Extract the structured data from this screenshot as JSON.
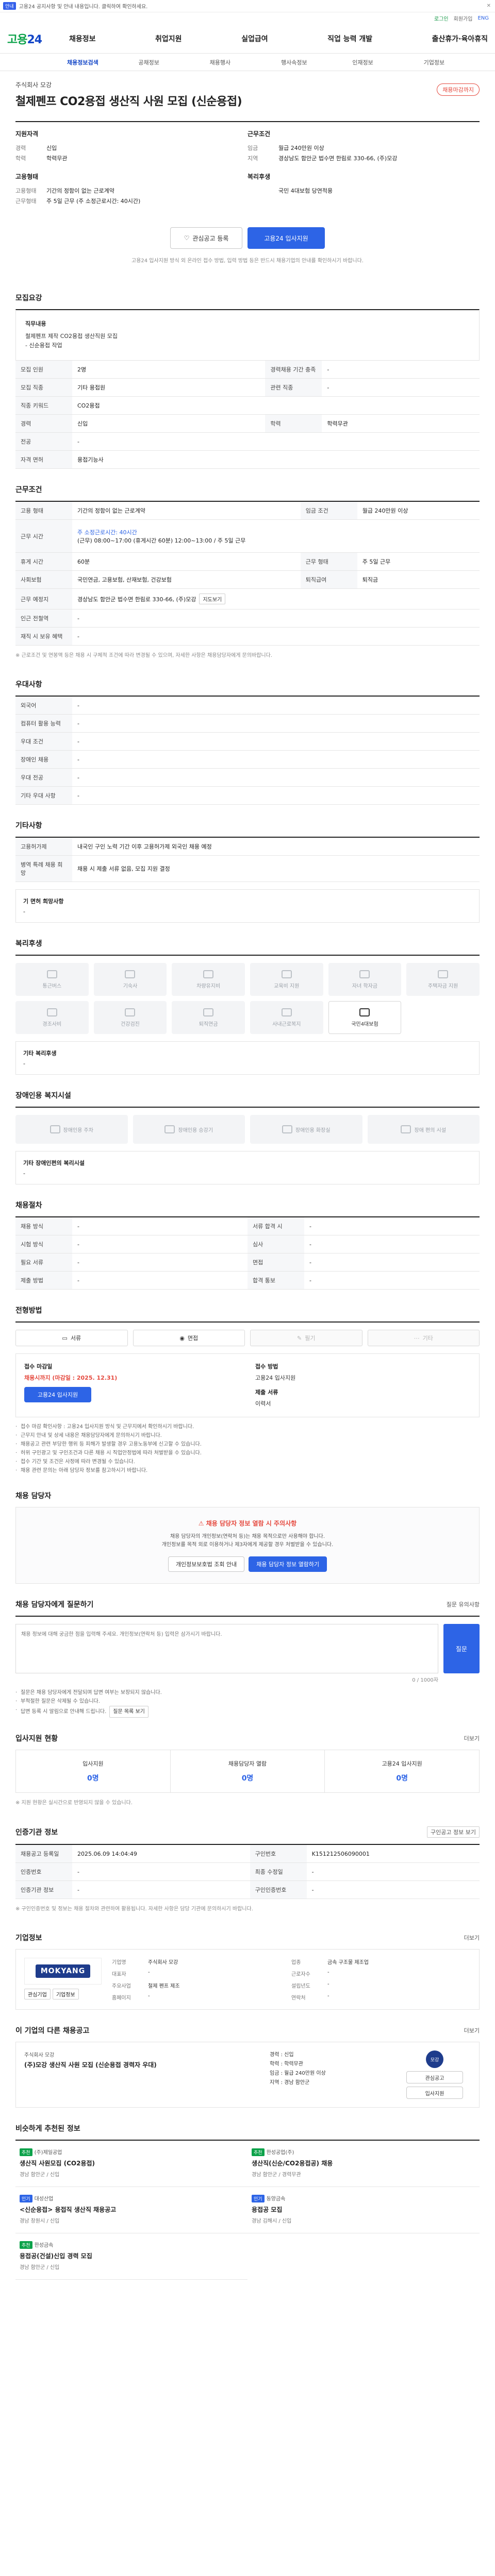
{
  "notice": {
    "tag": "안내",
    "text": "고용24 공지사항 및 안내 내용입니다. 클릭하여 확인하세요.",
    "close": "✕"
  },
  "util": {
    "items": [
      "로그인",
      "회원가입",
      "ENG"
    ]
  },
  "gnb": {
    "logo_main": "고용",
    "logo_num": "24",
    "menu": [
      "채용정보",
      "취업지원",
      "실업급여",
      "직업 능력 개발",
      "출산휴가·육아휴직"
    ]
  },
  "subnav": {
    "items": [
      "채용정보검색",
      "공채정보",
      "채용행사",
      "행사속정보",
      "인재정보",
      "기업정보"
    ]
  },
  "header": {
    "company": "주식회사 모강",
    "title": "철제펜프 CO2용접 생산직 사원 모집 (신순용접)",
    "dday": "채용마감까지",
    "left_title": "지원자격",
    "left": [
      {
        "k": "경력",
        "v": "신입"
      },
      {
        "k": "학력",
        "v": "학력무관"
      }
    ],
    "left_title2": "고용형태",
    "left2": [
      {
        "k": "고용형태",
        "v": "기간의 정함이 없는 근로계약"
      },
      {
        "k": "근무형태",
        "v": "주 5일 근무 (주 소정근로시간: 40시간)"
      }
    ],
    "right_title": "근무조건",
    "right": [
      {
        "k": "임금",
        "v": "월급 240만원 이상"
      },
      {
        "k": "지역",
        "v": "경상남도 함안군 법수면 한림로 330-66, (주)모강"
      }
    ],
    "right_title2": "복리후생",
    "right2": [
      {
        "k": "",
        "v": "국민 4대보험 당연적용"
      }
    ]
  },
  "actions": {
    "save": "관심공고 등록",
    "apply": "고용24 입사지원"
  },
  "action_note": "고용24 입사지원 방식 외 온라인 접수 방법, 입력 방법 등은 반드시 채용기업의 안내를 확인하시기 바랍니다.",
  "job_desc": {
    "title": "모집요강",
    "label": "직무내용",
    "lines": [
      "철제펜프 제작 CO2용접 생산직원 모집",
      "- 신순용접 작업"
    ]
  },
  "recruit_table": {
    "rows": [
      [
        {
          "k": "모집 인원",
          "v": "2명"
        },
        {
          "k": "경력채용 기간 충족",
          "v": "-"
        }
      ],
      [
        {
          "k": "모집 직종",
          "v": "기타 용접원"
        },
        {
          "k": "관련 직종",
          "v": "-"
        }
      ],
      [
        {
          "k": "직종 키워드",
          "v": "CO2용접"
        },
        {
          "k": "",
          "v": ""
        }
      ],
      [
        {
          "k": "경력",
          "v": "신입"
        },
        {
          "k": "학력",
          "v": "학력무관"
        }
      ],
      [
        {
          "k": "전공",
          "v": "-"
        },
        {
          "k": "",
          "v": ""
        }
      ],
      [
        {
          "k": "자격 면허",
          "v": "용접기능사"
        },
        {
          "k": "",
          "v": ""
        }
      ]
    ]
  },
  "work_cond": {
    "title": "근무조건",
    "rows": [
      [
        {
          "k": "고용 형태",
          "v": "기간의 정함이 없는 근로계약"
        },
        {
          "k": "임금 조건",
          "v": "월급 240만원 이상"
        }
      ],
      [
        {
          "k": "",
          "v": "주 소정근로시간: 40시간"
        },
        {
          "k": "",
          "v": ""
        }
      ],
      [
        {
          "k": "근무 시간",
          "v": "(근무) 08:00~17:00 (휴게시간 60분) 12:00~13:00 / 주 5일 근무"
        },
        {
          "k": "",
          "v": ""
        }
      ],
      [
        {
          "k": "휴게 시간",
          "v": "60분"
        },
        {
          "k": "근무 형태",
          "v": "주 5일 근무"
        }
      ],
      [
        {
          "k": "사회보험",
          "v": "국민연금, 고용보험, 산재보험, 건강보험"
        },
        {
          "k": "퇴직급여",
          "v": "퇴직금"
        }
      ],
      [
        {
          "k": "근무 예정지",
          "v": "경상남도 함안군 법수면 한림로 330-66, (주)모강"
        },
        {
          "k": "",
          "v": ""
        }
      ],
      [
        {
          "k": "인근 전철역",
          "v": "-"
        },
        {
          "k": "",
          "v": ""
        }
      ],
      [
        {
          "k": "재직 시 보유 혜택",
          "v": "-"
        },
        {
          "k": "",
          "v": ""
        }
      ]
    ],
    "map_btn": "지도보기",
    "hint": "※ 근로조건 및 연봉액 등은 채용 시 구체적 조건에 따라 변경될 수 있으며, 자세한 사항은 채용담당자에게 문의바랍니다."
  },
  "pref": {
    "title": "우대사항",
    "rows": [
      {
        "k": "외국어",
        "v": "-"
      },
      {
        "k": "컴퓨터 활용 능력",
        "v": "-"
      },
      {
        "k": "우대 조건",
        "v": "-"
      },
      {
        "k": "장애인 채용",
        "v": "-"
      },
      {
        "k": "우대 전공",
        "v": "-"
      },
      {
        "k": "기타 우대 사항",
        "v": "-"
      }
    ]
  },
  "other": {
    "title": "기타사항",
    "rows": [
      {
        "k": "고용허가제",
        "v": "내국인 구인 노력 기간 이후 고용허가제 외국인 채용 예정"
      },
      {
        "k": "병역 특례 채용 희망",
        "v": "채용 시 제출 서류 없음, 모집 지원 결정"
      }
    ],
    "extra_label": "기 면허 희망사항",
    "extra_val": "-"
  },
  "welfare": {
    "title": "복리후생",
    "items": [
      {
        "label": "통근버스",
        "on": false
      },
      {
        "label": "기숙사",
        "on": false
      },
      {
        "label": "차량유지비",
        "on": false
      },
      {
        "label": "교육비 지원",
        "on": false
      },
      {
        "label": "자녀 학자금",
        "on": false
      },
      {
        "label": "주택자금 지원",
        "on": false
      },
      {
        "label": "경조사비",
        "on": false
      },
      {
        "label": "건강검진",
        "on": false
      },
      {
        "label": "퇴직연금",
        "on": false
      },
      {
        "label": "사내근로복지",
        "on": false
      },
      {
        "label": "국민4대보험",
        "on": true
      }
    ],
    "desc_label": "기타 복리후생",
    "desc_val": "-"
  },
  "disabled": {
    "title": "장애인용 복지시설",
    "items": [
      "장애인용 주차",
      "장애인용 승강기",
      "장애인용 화장실",
      "장애 편의 시설"
    ],
    "desc_label": "기타 장애인편의 복리시설",
    "desc_val": "-"
  },
  "process": {
    "title": "채용절차",
    "rows": [
      {
        "k": "채용 방식",
        "v": "-"
      },
      {
        "k": "시험 방식",
        "v": "-"
      },
      {
        "k": "필요 서류",
        "v": "-"
      },
      {
        "k": "제출 방법",
        "v": "-"
      }
    ],
    "right": [
      {
        "k": "서류 합격 시",
        "v": "-"
      },
      {
        "k": "심사",
        "v": "-"
      },
      {
        "k": "면접",
        "v": "-"
      },
      {
        "k": "합격 통보",
        "v": "-"
      }
    ]
  },
  "apply_method": {
    "title": "전형방법",
    "methods": [
      {
        "label": "서류",
        "off": false
      },
      {
        "label": "면접",
        "off": false
      },
      {
        "label": "필기",
        "off": true
      },
      {
        "label": "기타",
        "off": true
      }
    ],
    "deadline_label": "접수 마감일",
    "deadline_val": "채용시까지 (마감일 : 2025. 12.31)",
    "method_label": "접수 방법",
    "method_val": "고용24 입사지원",
    "method_label2": "제출 서류",
    "method_val2": "이력서",
    "btn": "고용24 입사지원",
    "bullets": [
      "접수 마감 확인사항 : 고용24 입사지원 방식 및 근무지에서 확인하시기 바랍니다.",
      "근무지 안내 및 상세 내용은 채용담당자에게 문의하시기 바랍니다.",
      "채용공고 관련 부당한 행위 등 피해가 발생할 경우 고용노동부에 신고할 수 있습니다.",
      "허위 구인광고 및 구인조건과 다른 채용 시 직업안정법에 따라 처벌받을 수 있습니다.",
      "접수 기간 및 조건은 사정에 따라 변경될 수 있습니다.",
      "채용 관련 문의는 아래 담당자 정보를 참고하시기 바랍니다."
    ]
  },
  "contact": {
    "title": "채용 담당자",
    "warn": "채용 담당자 정보 열람 시 주의사항",
    "lines": [
      "채용 담당자의 개인정보(연락처 등)는 채용 목적으로만 사용해야 합니다.",
      "개인정보를 목적 외로 이용하거나 제3자에게 제공할 경우 처벌받을 수 있습니다."
    ],
    "btn1": "개인정보보호법 조회 안내",
    "btn2": "채용 담당자 정보 열람하기"
  },
  "inquiry": {
    "title": "채용 담당자에게 질문하기",
    "more": "질문 유의사항",
    "placeholder": "채용 정보에 대해 궁금한 점을 입력해 주세요. 개인정보(연락처 등) 입력은 삼가시기 바랍니다.",
    "counter": "0 / 1000자",
    "send": "질문",
    "bullets": [
      "질문은 채용 담당자에게 전달되며 답변 여부는 보장되지 않습니다.",
      "부적절한 질문은 삭제될 수 있습니다.",
      "답변 등록 시 알림으로 안내해 드립니다."
    ],
    "btn": "질문 목록 보기"
  },
  "status": {
    "title": "입사지원 현황",
    "more": "더보기",
    "items": [
      {
        "l": "입사지원",
        "n": "0명"
      },
      {
        "l": "채용담당자 열람",
        "n": "0명"
      },
      {
        "l": "고용24 입사지원",
        "n": "0명"
      }
    ],
    "note": "※ 지원 현황은 실시간으로 반영되지 않을 수 있습니다."
  },
  "job_info": {
    "title": "인증기관 정보",
    "more": "구인공고 정보 보기",
    "rows": [
      [
        {
          "k": "채용공고 등록일",
          "v": "2025.06.09 14:04:49"
        },
        {
          "k": "구인번호",
          "v": "K151212506090001"
        }
      ],
      [
        {
          "k": "인증번호",
          "v": "-"
        },
        {
          "k": "최종 수정일",
          "v": "-"
        }
      ],
      [
        {
          "k": "인증기관 정보",
          "v": "-"
        },
        {
          "k": "구인인증번호",
          "v": "-"
        }
      ]
    ],
    "note": "※ 구인인증번호 및 정보는 채용 절차와 관련하여 활용됩니다. 자세한 사항은 담당 기관에 문의하시기 바랍니다."
  },
  "company": {
    "title": "기업정보",
    "more": "더보기",
    "logo": "MOKYANG",
    "btn1": "관심기업",
    "btn2": "기업정보",
    "rows": [
      {
        "k": "기업명",
        "v": "주식회사 모강"
      },
      {
        "k": "업종",
        "v": "금속 구조물 제조업"
      },
      {
        "k": "대표자",
        "v": "-"
      },
      {
        "k": "근로자수",
        "v": "-"
      },
      {
        "k": "주요사업",
        "v": "철제 펜프 제조"
      },
      {
        "k": "설립년도",
        "v": "-"
      },
      {
        "k": "홈페이지",
        "v": "-"
      },
      {
        "k": "연락처",
        "v": "-"
      }
    ]
  },
  "other_jobs": {
    "title": "이 기업의 다른 채용공고",
    "more": "더보기",
    "company": "주식회사 모강",
    "job_title": "(주)모강 생산직 사원 모집 (신순용접 경력자 우대)",
    "meta": [
      "경력 : 신입",
      "학력 : 학력무관",
      "임금 : 월급 240만원 이상",
      "지역 : 경남 함안군"
    ],
    "badge": "모강",
    "btn1": "관심공고",
    "btn2": "입사지원"
  },
  "recommended": {
    "title": "비슷하게 추천된 정보",
    "items": [
      {
        "tag": "추천",
        "co": "(주)제일공업",
        "t": "생산직 사원모집 (CO2용접)",
        "meta": "경남 함안군 / 신입"
      },
      {
        "tag": "추천",
        "co": "한성공업(주)",
        "t": "생산직(신순/CO2용접공) 채용",
        "meta": "경남 함안군 / 경력무관"
      },
      {
        "tag": "인기",
        "co": "대성산업",
        "t": "<신순용접> 용접직 생산직 채용공고",
        "meta": "경남 창원시 / 신입"
      },
      {
        "tag": "인기",
        "co": "동양금속",
        "t": "용접공 모집",
        "meta": "경남 김해시 / 신입"
      },
      {
        "tag": "추천",
        "co": "한성금속",
        "t": "용접공(건설)신입 경력 모집",
        "meta": "경남 함안군 / 신입"
      }
    ]
  }
}
